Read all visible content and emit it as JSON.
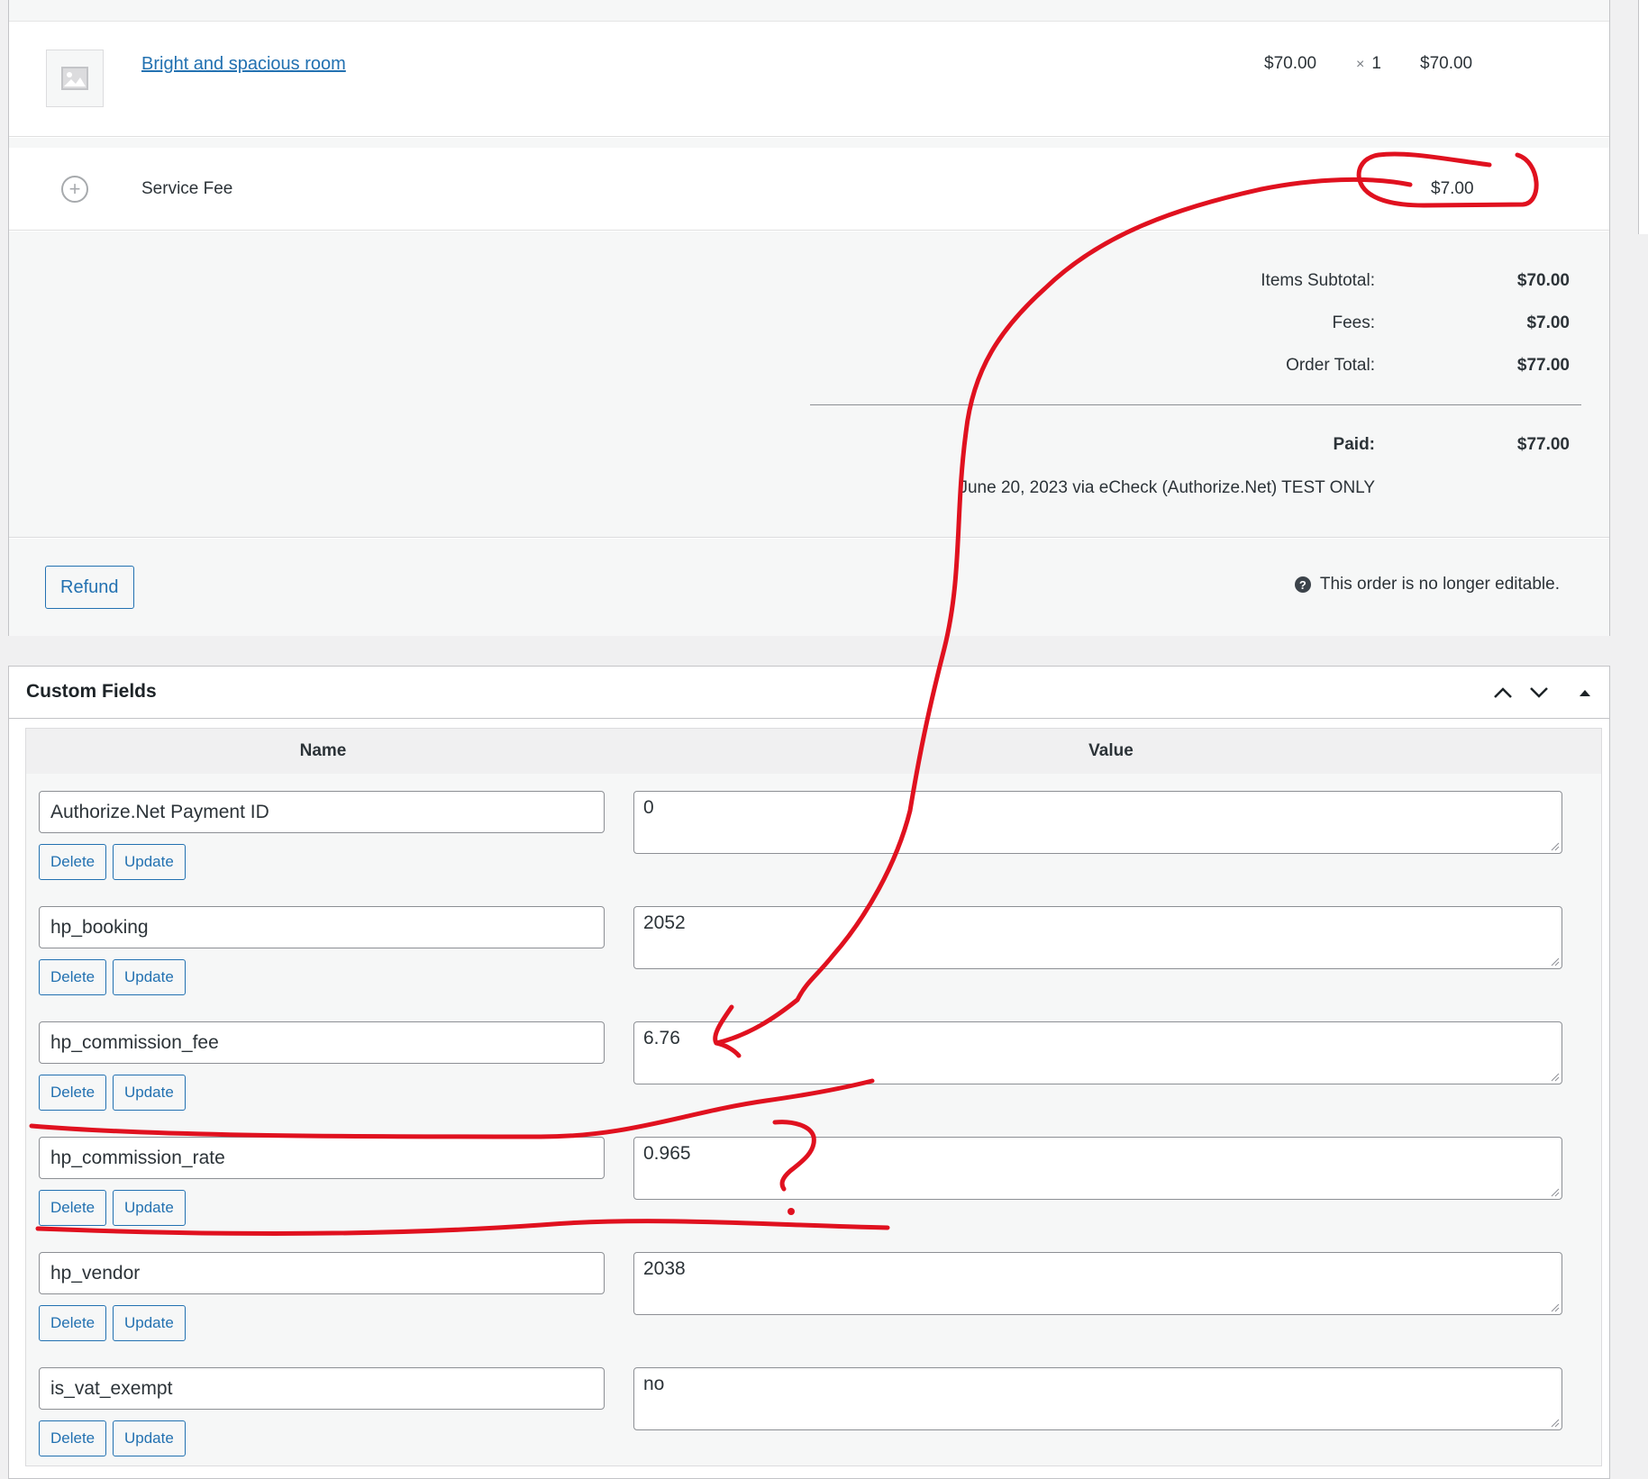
{
  "order_items": {
    "item": {
      "name": "Bright and spacious room",
      "cost": "$70.00",
      "qty_symbol": "×",
      "qty": "1",
      "total": "$70.00"
    },
    "fee": {
      "name": "Service Fee",
      "total": "$7.00"
    },
    "totals": {
      "subtotal_label": "Items Subtotal:",
      "subtotal_value": "$70.00",
      "fees_label": "Fees:",
      "fees_value": "$7.00",
      "order_total_label": "Order Total:",
      "order_total_value": "$77.00",
      "paid_label": "Paid:",
      "paid_value": "$77.00",
      "paid_note": "June 20, 2023 via eCheck (Authorize.Net) TEST ONLY"
    },
    "refund_label": "Refund",
    "not_editable_text": "This order is no longer editable.",
    "help_icon_glyph": "?"
  },
  "custom_fields": {
    "title": "Custom Fields",
    "col_name": "Name",
    "col_value": "Value",
    "delete_label": "Delete",
    "update_label": "Update",
    "rows": [
      {
        "name": "Authorize.Net Payment ID",
        "value": "0"
      },
      {
        "name": "hp_booking",
        "value": "2052"
      },
      {
        "name": "hp_commission_fee",
        "value": "6.76"
      },
      {
        "name": "hp_commission_rate",
        "value": "0.965"
      },
      {
        "name": "hp_vendor",
        "value": "2038"
      },
      {
        "name": "is_vat_exempt",
        "value": "no"
      }
    ]
  },
  "colors": {
    "link": "#2271b1",
    "annotation": "#e0111f"
  }
}
